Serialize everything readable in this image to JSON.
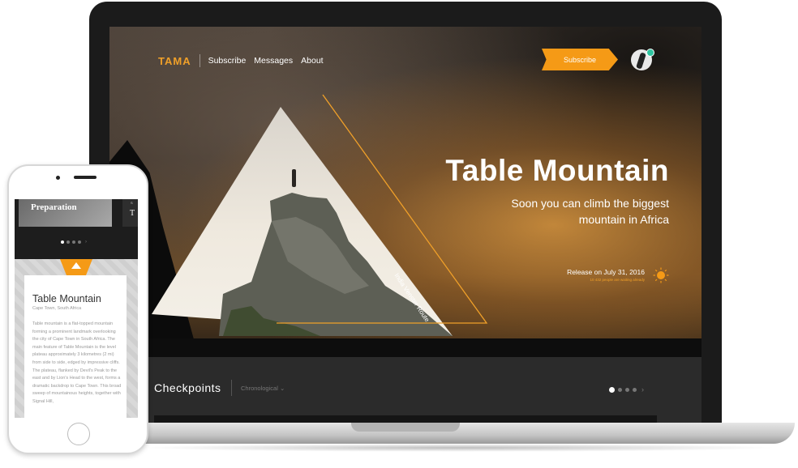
{
  "laptop": {
    "nav": {
      "logo": "TAMA",
      "links": [
        "Subscribe",
        "Messages",
        "About"
      ]
    },
    "subscribe_button": "Subscribe",
    "hero": {
      "title": "Table Mountain",
      "subtitle_line1": "Soon you can climb the biggest",
      "subtitle_line2": "mountain in Africa",
      "route_label": "India Venster Route",
      "release": "Release on July 31, 2016",
      "release_note": "10 432 people are waiting already"
    },
    "checkpoints": {
      "title": "Checkpoints",
      "sort_label": "Chronological",
      "pager_count": 4,
      "pager_active": 0
    },
    "colors": {
      "accent": "#f59a16",
      "avatar_status": "#2ec4a0"
    }
  },
  "phone": {
    "slide_title": "Preparation",
    "slide_next_initial": "T",
    "slide_next_small": "S",
    "pager_count": 4,
    "pager_active": 0,
    "card": {
      "title": "Table Mountain",
      "location": "Cape Town, South Africa",
      "body": "Table mountain is a flat-topped mountain forming a prominent landmark overlooking the city of Cape Town in South Africa. The main feature of Table Mountain is the level plateau approximately 3 kilometres (2 mi) from side to side, edged by impressive cliffs. The plateau, flanked by Devil's Peak to the east and by Lion's Head to the west, forms a dramatic backdrop to Cape Town. This broad sweep of mountainous heights, together with Signal Hill,"
    }
  }
}
